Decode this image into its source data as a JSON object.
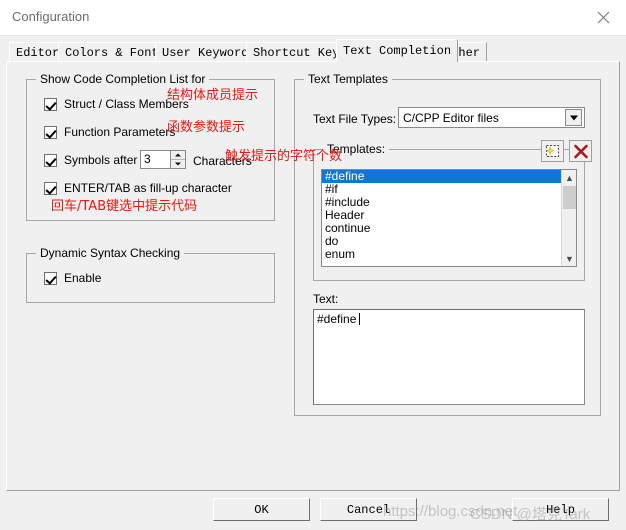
{
  "window": {
    "title": "Configuration",
    "close_icon": "close-icon"
  },
  "tabs": [
    {
      "label": "Editor",
      "active": false
    },
    {
      "label": "Colors & Fonts",
      "active": false
    },
    {
      "label": "User Keywords",
      "active": false
    },
    {
      "label": "Shortcut Keys",
      "active": false
    },
    {
      "label": "Text Completion",
      "active": true
    },
    {
      "label": "Other",
      "active": false
    }
  ],
  "code_completion_group": {
    "caption": "Show Code Completion List for",
    "items": [
      {
        "label": "Struct / Class Members",
        "checked": true
      },
      {
        "label": "Function Parameters",
        "checked": true
      },
      {
        "label": "Symbols after",
        "checked": true,
        "suffix": "Characters",
        "value": "3"
      },
      {
        "label": "ENTER/TAB as fill-up character",
        "checked": true
      }
    ]
  },
  "dynamic_syntax_group": {
    "caption": "Dynamic Syntax Checking",
    "enable_label": "Enable",
    "enable_checked": true
  },
  "annotations": [
    {
      "text": "结构体成员提示"
    },
    {
      "text": "函数参数提示"
    },
    {
      "text": "触发提示的字符个数"
    },
    {
      "text": "回车/TAB键选中提示代码"
    }
  ],
  "text_templates_group": {
    "caption": "Text Templates",
    "file_types_label": "Text File Types:",
    "file_types_value": "C/CPP Editor files",
    "templates_caption": "Templates:",
    "new_icon": "new-template-icon",
    "delete_icon": "delete-template-icon",
    "templates": [
      {
        "name": "#define",
        "selected": true
      },
      {
        "name": "#if",
        "selected": false
      },
      {
        "name": "#include",
        "selected": false
      },
      {
        "name": "Header",
        "selected": false
      },
      {
        "name": "continue",
        "selected": false
      },
      {
        "name": "do",
        "selected": false
      },
      {
        "name": "enum",
        "selected": false
      }
    ],
    "text_label": "Text:",
    "text_value": "#define"
  },
  "buttons": {
    "ok": "OK",
    "cancel": "Cancel",
    "help": "Help"
  },
  "watermark": {
    "url": "https://blog.csdn.net",
    "name": "CSDN @塔克Tark"
  },
  "colors": {
    "selection": "#0a78d7",
    "annotation": "#f01414",
    "dialog_face": "#f0f0f0"
  }
}
